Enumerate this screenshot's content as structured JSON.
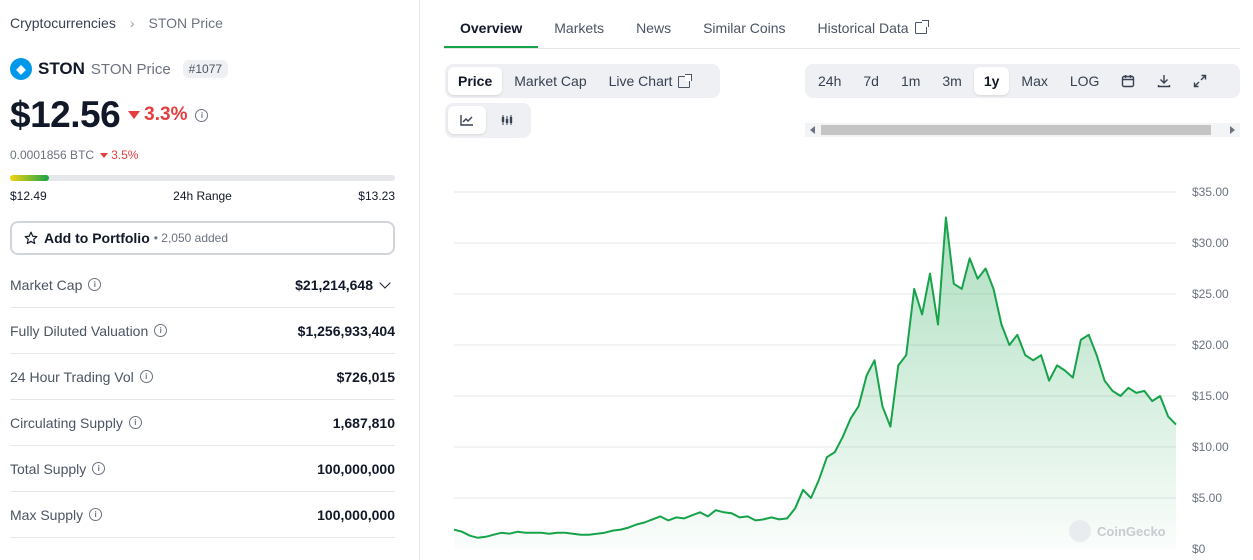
{
  "breadcrumb": {
    "root": "Cryptocurrencies",
    "current": "STON Price"
  },
  "coin": {
    "symbol": "STON",
    "name_suffix": "STON Price",
    "rank": "#1077",
    "logo_color": "#0098ea"
  },
  "price": {
    "value": "$12.56",
    "change": "3.3%",
    "btc_value": "0.0001856 BTC",
    "btc_change": "3.5%"
  },
  "range": {
    "low": "$12.49",
    "label": "24h Range",
    "high": "$13.23",
    "position_pct": 10
  },
  "portfolio": {
    "label": "Add to Portfolio",
    "added": "• 2,050 added"
  },
  "stats": [
    {
      "label": "Market Cap",
      "value": "$21,214,648"
    },
    {
      "label": "Fully Diluted Valuation",
      "value": "$1,256,933,404"
    },
    {
      "label": "24 Hour Trading Vol",
      "value": "$726,015"
    },
    {
      "label": "Circulating Supply",
      "value": "1,687,810"
    },
    {
      "label": "Total Supply",
      "value": "100,000,000"
    },
    {
      "label": "Max Supply",
      "value": "100,000,000"
    }
  ],
  "tabs": [
    "Overview",
    "Markets",
    "News",
    "Similar Coins",
    "Historical Data"
  ],
  "chart_type_buttons": [
    "Price",
    "Market Cap",
    "Live Chart"
  ],
  "range_buttons": [
    "24h",
    "7d",
    "1m",
    "3m",
    "1y",
    "Max",
    "LOG"
  ],
  "watermark": "CoinGecko",
  "colors": {
    "accent_green": "#16a34a",
    "down_red": "#e53e3e"
  },
  "chart_data": {
    "type": "area",
    "ylabel": "",
    "yticks": [
      "$0",
      "$5.00",
      "$10.00",
      "$15.00",
      "$20.00",
      "$25.00",
      "$30.00",
      "$35.00"
    ],
    "ylim": [
      0,
      35
    ],
    "series": [
      {
        "values": [
          1.9,
          1.7,
          1.3,
          1.1,
          1.2,
          1.4,
          1.6,
          1.5,
          1.7,
          1.6,
          1.6,
          1.6,
          1.5,
          1.6,
          1.6,
          1.5,
          1.4,
          1.4,
          1.5,
          1.6,
          1.8,
          1.9,
          2.1,
          2.4,
          2.6,
          2.9,
          3.2,
          2.8,
          3.1,
          3.0,
          3.3,
          3.6,
          3.2,
          3.8,
          3.6,
          3.5,
          3.1,
          3.2,
          2.8,
          2.9,
          3.1,
          2.9,
          3.0,
          4.0,
          5.8,
          5.0,
          6.8,
          9.0,
          9.5,
          11.0,
          12.8,
          14.0,
          17.0,
          18.5,
          14.0,
          12.0,
          18.0,
          19.0,
          25.5,
          23.0,
          27.0,
          22.0,
          32.5,
          26.0,
          25.5,
          28.5,
          26.5,
          27.5,
          25.5,
          22.0,
          20.0,
          21.0,
          19.0,
          18.5,
          19.0,
          16.5,
          18.0,
          17.5,
          16.8,
          20.5,
          21.0,
          19.0,
          16.5,
          15.5,
          15.0,
          15.8,
          15.3,
          15.5,
          14.5,
          15.0,
          13.0,
          12.2
        ]
      }
    ]
  }
}
